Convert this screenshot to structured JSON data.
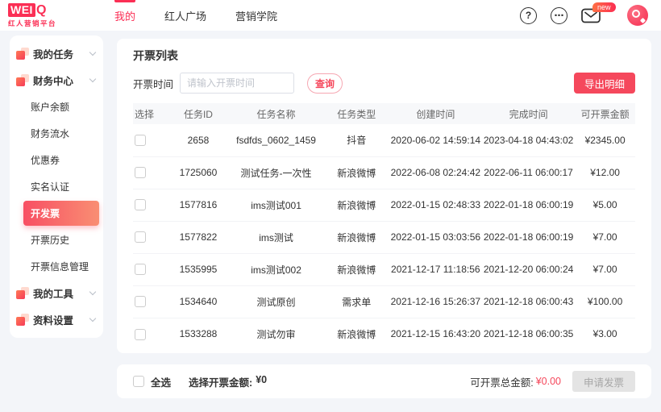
{
  "brand": {
    "logo_box": "WEI",
    "logo_q": "Q",
    "tagline": "红人营销平台"
  },
  "nav": {
    "items": [
      {
        "label": "我的",
        "active": true
      },
      {
        "label": "红人广场",
        "active": false
      },
      {
        "label": "营销学院",
        "active": false
      }
    ],
    "badge": "new"
  },
  "icons": {
    "help_glyph": "?",
    "more_glyph": "⋯"
  },
  "sidebar": {
    "groups": [
      {
        "label": "我的任务",
        "icon": "tasks-icon",
        "expanded": false
      },
      {
        "label": "财务中心",
        "icon": "finance-icon",
        "expanded": true,
        "children": [
          {
            "label": "账户余额",
            "active": false
          },
          {
            "label": "财务流水",
            "active": false
          },
          {
            "label": "优惠券",
            "active": false
          },
          {
            "label": "实名认证",
            "active": false
          },
          {
            "label": "开发票",
            "active": true
          },
          {
            "label": "开票历史",
            "active": false
          },
          {
            "label": "开票信息管理",
            "active": false
          }
        ]
      },
      {
        "label": "我的工具",
        "icon": "tools-icon",
        "expanded": false
      },
      {
        "label": "资料设置",
        "icon": "profile-icon",
        "expanded": false
      }
    ]
  },
  "main": {
    "title": "开票列表",
    "filter": {
      "label": "开票时间",
      "placeholder": "请输入开票时间",
      "search_button": "查询"
    },
    "export_button": "导出明细",
    "table": {
      "columns": [
        "选择",
        "任务ID",
        "任务名称",
        "任务类型",
        "创建时间",
        "完成时间",
        "可开票金额"
      ],
      "rows": [
        {
          "id": "2658",
          "name": "fsdfds_0602_1459",
          "type": "抖音",
          "created": "2020-06-02 14:59:14",
          "finished": "2023-04-18 04:43:02",
          "amount": "¥2345.00",
          "checked": false
        },
        {
          "id": "1725060",
          "name": "测试任务-一次性",
          "type": "新浪微博",
          "created": "2022-06-08 02:24:42",
          "finished": "2022-06-11 06:00:17",
          "amount": "¥12.00",
          "checked": false
        },
        {
          "id": "1577816",
          "name": "ims测试001",
          "type": "新浪微博",
          "created": "2022-01-15 02:48:33",
          "finished": "2022-01-18 06:00:19",
          "amount": "¥5.00",
          "checked": false
        },
        {
          "id": "1577822",
          "name": "ims测试",
          "type": "新浪微博",
          "created": "2022-01-15 03:03:56",
          "finished": "2022-01-18 06:00:19",
          "amount": "¥7.00",
          "checked": false
        },
        {
          "id": "1535995",
          "name": "ims测试002",
          "type": "新浪微博",
          "created": "2021-12-17 11:18:56",
          "finished": "2021-12-20 06:00:24",
          "amount": "¥7.00",
          "checked": false
        },
        {
          "id": "1534640",
          "name": "测试原创",
          "type": "需求单",
          "created": "2021-12-16 15:26:37",
          "finished": "2021-12-18 06:00:43",
          "amount": "¥100.00",
          "checked": false
        },
        {
          "id": "1533288",
          "name": "测试勿审",
          "type": "新浪微博",
          "created": "2021-12-15 16:43:20",
          "finished": "2021-12-18 06:00:35",
          "amount": "¥3.00",
          "checked": false
        }
      ]
    },
    "footer": {
      "select_all": "全选",
      "selected_label": "选择开票金额:",
      "selected_amount": "¥0",
      "total_label": "可开票总金额:",
      "total_amount": "¥0.00",
      "apply_button": "申请发票"
    }
  },
  "colors": {
    "brand_red": "#fb2f55",
    "button_red": "#f5485c",
    "page_bg": "#f3f5f9",
    "active_item_gradient_start": "#f84f63",
    "active_item_gradient_end": "#f98e73"
  }
}
